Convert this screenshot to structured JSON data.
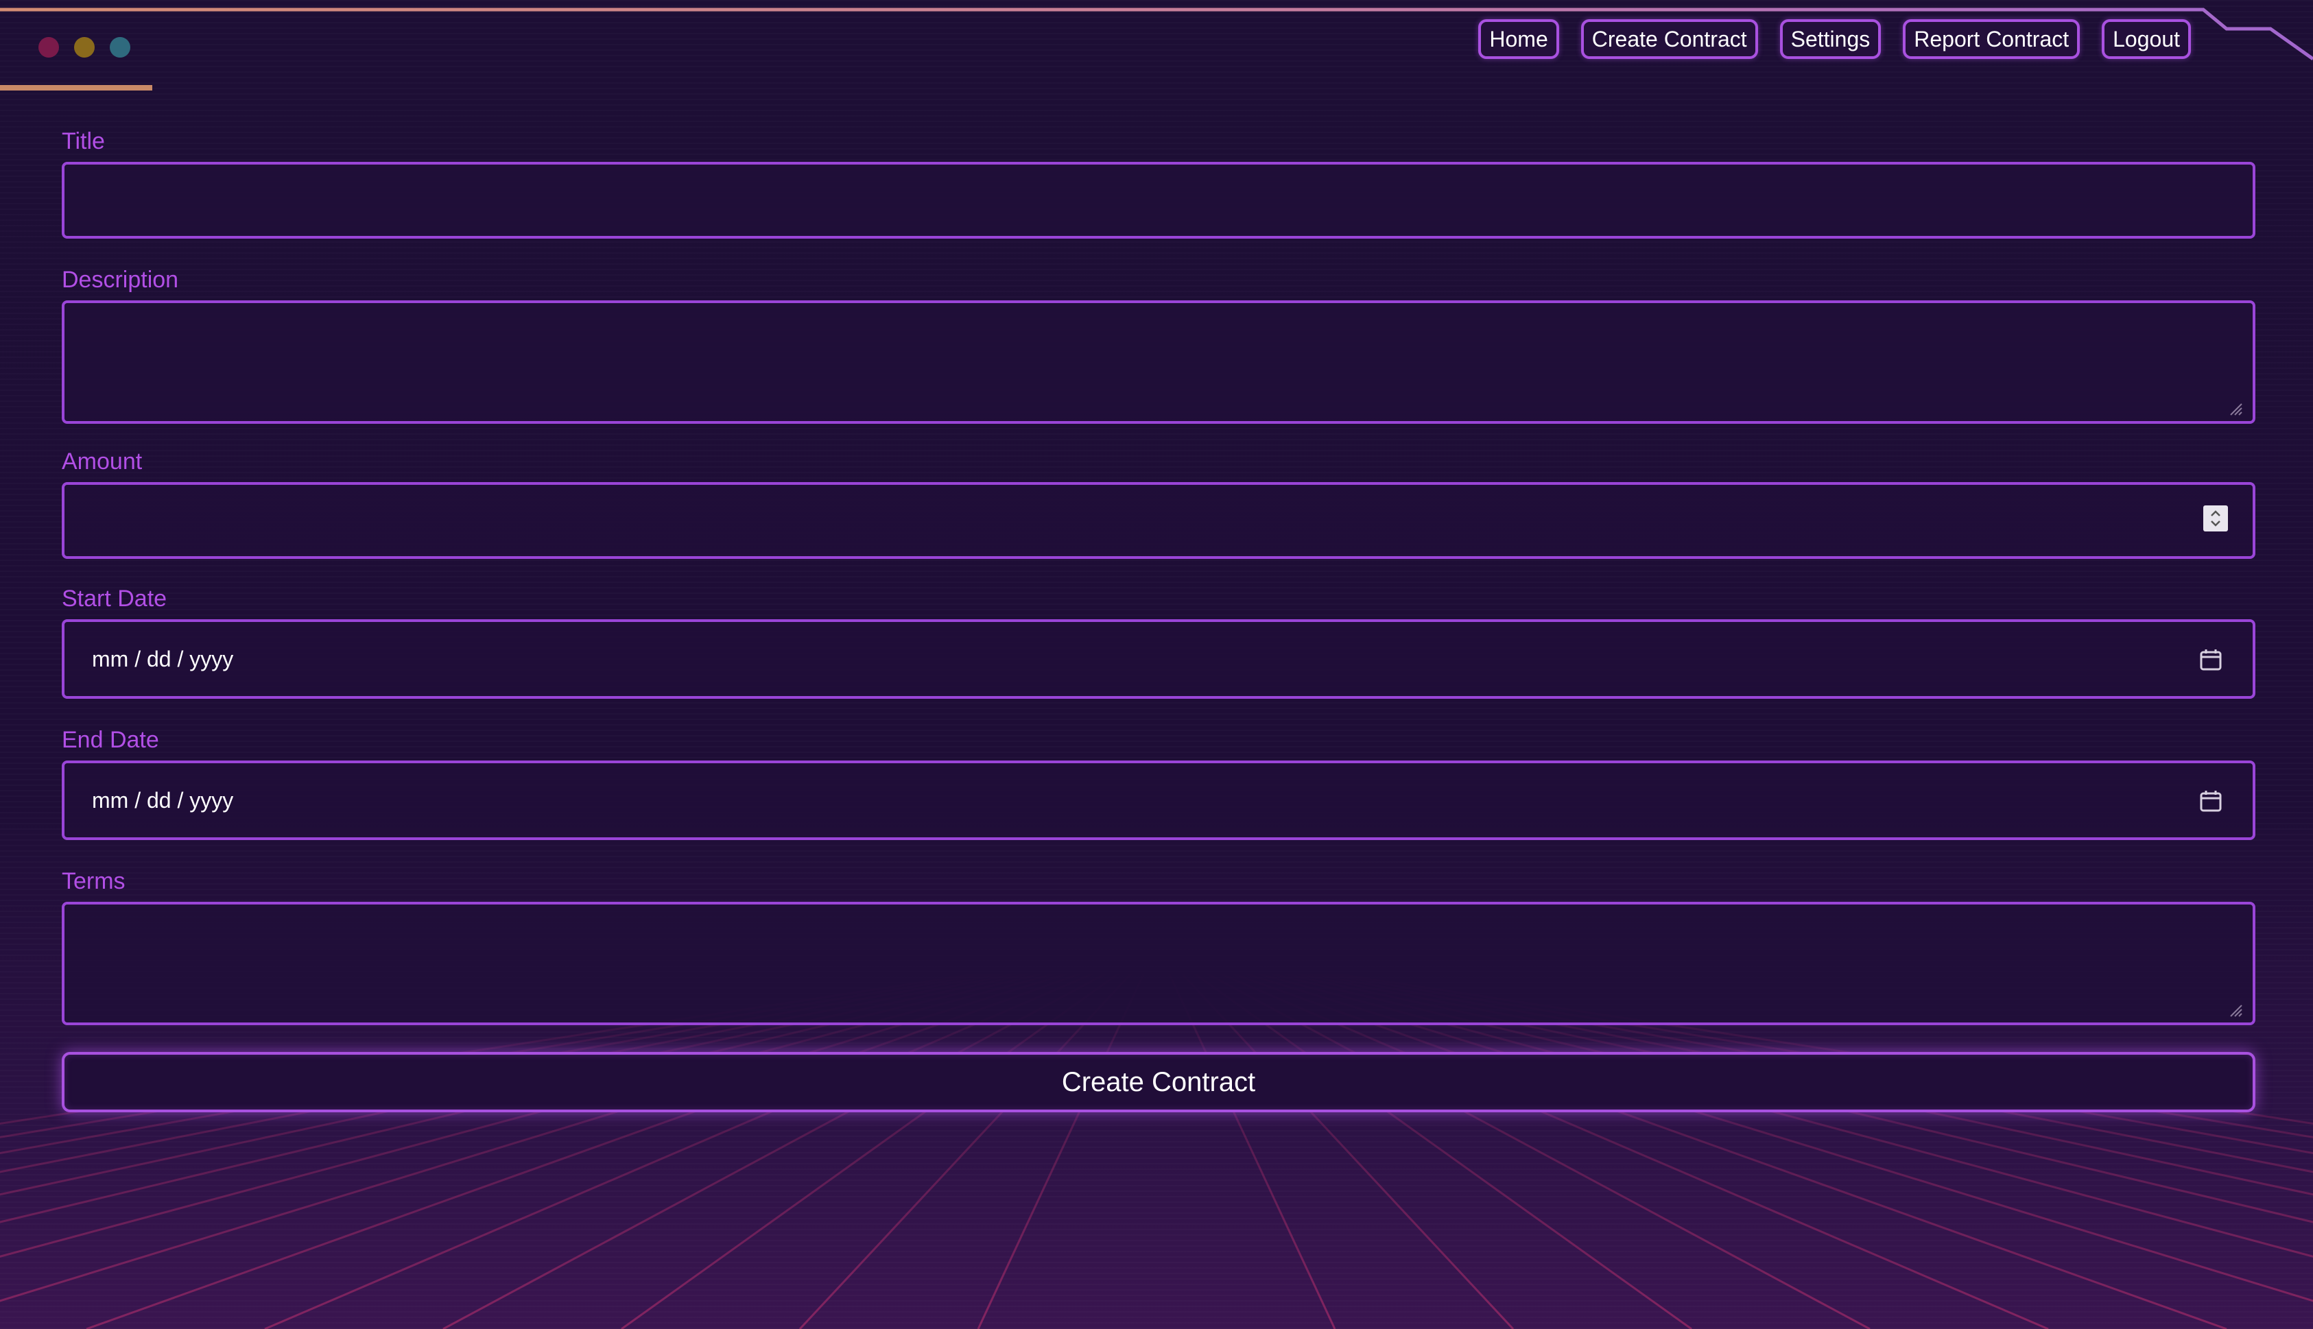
{
  "nav": {
    "home": "Home",
    "create_contract": "Create Contract",
    "settings": "Settings",
    "report_contract": "Report Contract",
    "logout": "Logout"
  },
  "form": {
    "title_label": "Title",
    "title_value": "",
    "description_label": "Description",
    "description_value": "",
    "amount_label": "Amount",
    "amount_value": "",
    "start_date_label": "Start Date",
    "start_date_placeholder": "mm / dd / yyyy",
    "end_date_label": "End Date",
    "end_date_placeholder": "mm / dd / yyyy",
    "terms_label": "Terms",
    "terms_value": "",
    "submit_label": "Create Contract"
  },
  "colors": {
    "accent": "#a951e0",
    "label": "#b24fe6",
    "background": "#1c0d33",
    "frame_orange": "#e8907a"
  }
}
